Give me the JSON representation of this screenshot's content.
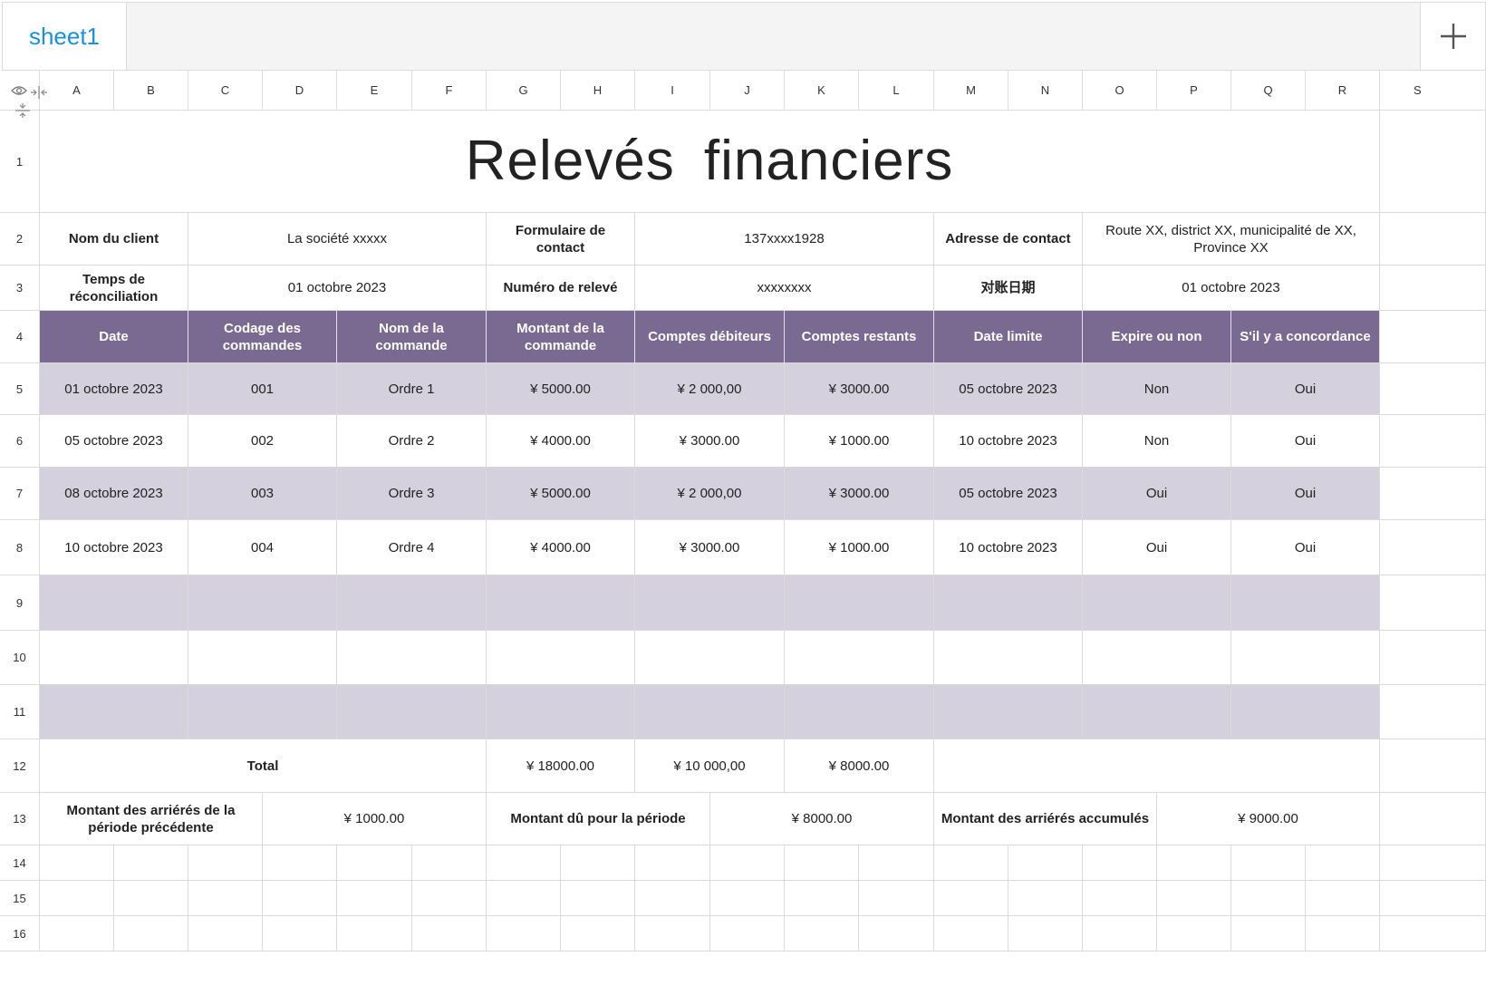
{
  "tabs": {
    "active": "sheet1"
  },
  "columns": [
    "A",
    "B",
    "C",
    "D",
    "E",
    "F",
    "G",
    "H",
    "I",
    "J",
    "K",
    "L",
    "M",
    "N",
    "O",
    "P",
    "Q",
    "R",
    "S"
  ],
  "rows": [
    "1",
    "2",
    "3",
    "4",
    "5",
    "6",
    "7",
    "8",
    "9",
    "10",
    "11",
    "12",
    "13",
    "14",
    "15",
    "16"
  ],
  "title": "Relevés financiers",
  "info": {
    "client_label": "Nom du client",
    "client_value": "La société xxxxx",
    "contact_form_label": "Formulaire de contact",
    "contact_form_value": "137xxxx1928",
    "address_label": "Adresse de contact",
    "address_value": "Route XX, district XX, municipalité de XX, Province XX",
    "recon_time_label": "Temps de réconciliation",
    "recon_time_value": "01 octobre 2023",
    "statement_no_label": "Numéro de relevé",
    "statement_no_value": "xxxxxxxx",
    "recon_date_label": "对账日期",
    "recon_date_value": "01 octobre 2023"
  },
  "table": {
    "headers": [
      "Date",
      "Codage des commandes",
      "Nom de la commande",
      "Montant de la commande",
      "Comptes débiteurs",
      "Comptes restants",
      "Date limite",
      "Expire ou non",
      "S'il y a concordance"
    ],
    "rows": [
      [
        "01 octobre 2023",
        "001",
        "Ordre 1",
        "¥ 5000.00",
        "¥ 2 000,00",
        "¥ 3000.00",
        "05 octobre 2023",
        "Non",
        "Oui"
      ],
      [
        "05 octobre 2023",
        "002",
        "Ordre 2",
        "¥ 4000.00",
        "¥ 3000.00",
        "¥ 1000.00",
        "10 octobre 2023",
        "Non",
        "Oui"
      ],
      [
        "08 octobre 2023",
        "003",
        "Ordre 3",
        "¥ 5000.00",
        "¥ 2 000,00",
        "¥ 3000.00",
        "05 octobre 2023",
        "Oui",
        "Oui"
      ],
      [
        "10 octobre 2023",
        "004",
        "Ordre 4",
        "¥ 4000.00",
        "¥ 3000.00",
        "¥ 1000.00",
        "10 octobre 2023",
        "Oui",
        "Oui"
      ]
    ]
  },
  "totals": {
    "label": "Total",
    "amount": "¥ 18000.00",
    "debits": "¥ 10 000,00",
    "remaining": "¥ 8000.00"
  },
  "summary": {
    "prev_arrears_label": "Montant des arriérés de la période précédente",
    "prev_arrears_value": "¥ 1000.00",
    "due_label": "Montant dû pour la période",
    "due_value": "¥ 8000.00",
    "accum_label": "Montant des arriérés accumulés",
    "accum_value": "¥ 9000.00"
  },
  "colors": {
    "header_bg": "#7a6a92",
    "band_bg": "#d5d0dd",
    "tab_text": "#1a8fe3"
  }
}
